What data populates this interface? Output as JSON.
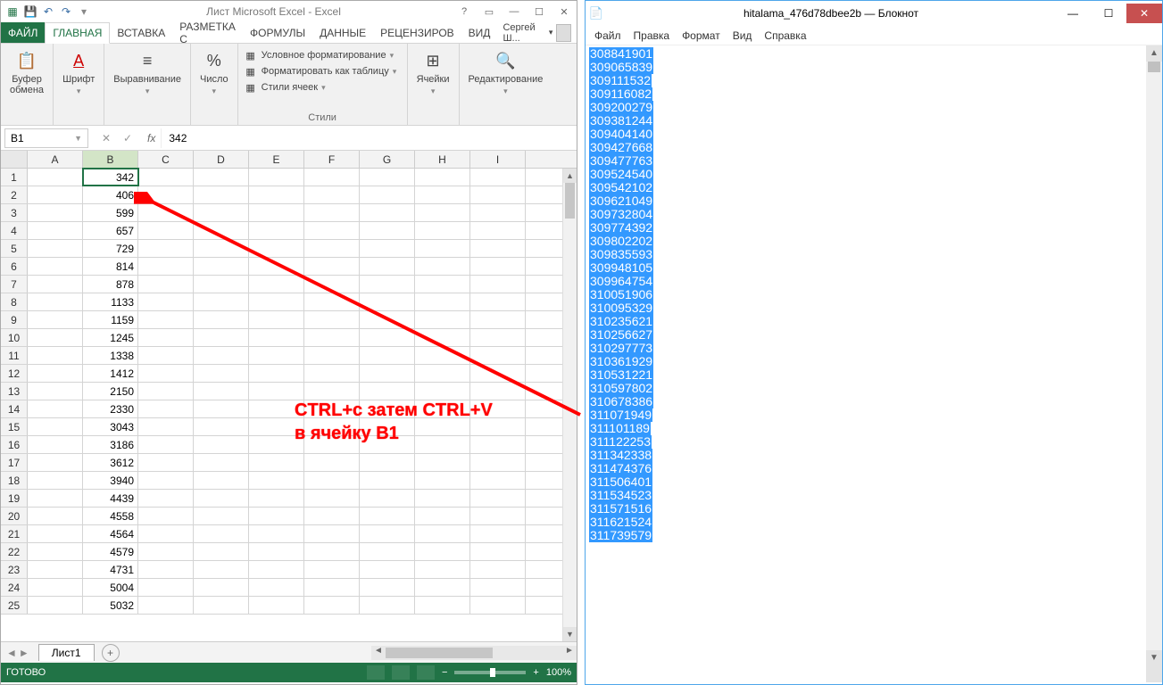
{
  "excel": {
    "title": "Лист Microsoft Excel - Excel",
    "qat_icons": [
      "excel-icon",
      "save-icon",
      "undo-icon",
      "redo-icon",
      "customize-icon"
    ],
    "tabs": {
      "file": "ФАЙЛ",
      "home": "ГЛАВНАЯ",
      "insert": "ВСТАВКА",
      "layout": "РАЗМЕТКА С",
      "formulas": "ФОРМУЛЫ",
      "data": "ДАННЫЕ",
      "review": "РЕЦЕНЗИРОВ",
      "view": "ВИД"
    },
    "user": "Сергей Ш...",
    "ribbon": {
      "clipboard": {
        "label": "Буфер\nобмена",
        "group": ""
      },
      "font": {
        "label": "Шрифт"
      },
      "align": {
        "label": "Выравнивание"
      },
      "number": {
        "label": "Число"
      },
      "styles": {
        "cond": "Условное форматирование",
        "table": "Форматировать как таблицу",
        "cell": "Стили ячеек",
        "group": "Стили"
      },
      "cells": {
        "label": "Ячейки"
      },
      "editing": {
        "label": "Редактирование"
      }
    },
    "namebox": "B1",
    "formula": "342",
    "columns": [
      "A",
      "B",
      "C",
      "D",
      "E",
      "F",
      "G",
      "H",
      "I"
    ],
    "rows": [
      {
        "n": 1,
        "b": "342"
      },
      {
        "n": 2,
        "b": "406"
      },
      {
        "n": 3,
        "b": "599"
      },
      {
        "n": 4,
        "b": "657"
      },
      {
        "n": 5,
        "b": "729"
      },
      {
        "n": 6,
        "b": "814"
      },
      {
        "n": 7,
        "b": "878"
      },
      {
        "n": 8,
        "b": "1133"
      },
      {
        "n": 9,
        "b": "1159"
      },
      {
        "n": 10,
        "b": "1245"
      },
      {
        "n": 11,
        "b": "1338"
      },
      {
        "n": 12,
        "b": "1412"
      },
      {
        "n": 13,
        "b": "2150"
      },
      {
        "n": 14,
        "b": "2330"
      },
      {
        "n": 15,
        "b": "3043"
      },
      {
        "n": 16,
        "b": "3186"
      },
      {
        "n": 17,
        "b": "3612"
      },
      {
        "n": 18,
        "b": "3940"
      },
      {
        "n": 19,
        "b": "4439"
      },
      {
        "n": 20,
        "b": "4558"
      },
      {
        "n": 21,
        "b": "4564"
      },
      {
        "n": 22,
        "b": "4579"
      },
      {
        "n": 23,
        "b": "4731"
      },
      {
        "n": 24,
        "b": "5004"
      },
      {
        "n": 25,
        "b": "5032"
      }
    ],
    "sheet": "Лист1",
    "status": "ГОТОВО",
    "zoom": "100%"
  },
  "annotation": {
    "line1": "CTRL+c  затем CTRL+V",
    "line2": "в ячейку B1"
  },
  "notepad": {
    "title": "hitalama_476d78dbee2b — Блокнот",
    "menu": [
      "Файл",
      "Правка",
      "Формат",
      "Вид",
      "Справка"
    ],
    "lines": [
      "308841901",
      "309065839",
      "309111532",
      "309116082",
      "309200279",
      "309381244",
      "309404140",
      "309427668",
      "309477763",
      "309524540",
      "309542102",
      "309621049",
      "309732804",
      "309774392",
      "309802202",
      "309835593",
      "309948105",
      "309964754",
      "310051906",
      "310095329",
      "310235621",
      "310256627",
      "310297773",
      "310361929",
      "310531221",
      "310597802",
      "310678386",
      "311071949",
      "311101189",
      "311122253",
      "311342338",
      "311474376",
      "311506401",
      "311534523",
      "311571516",
      "311621524",
      "311739579"
    ]
  }
}
